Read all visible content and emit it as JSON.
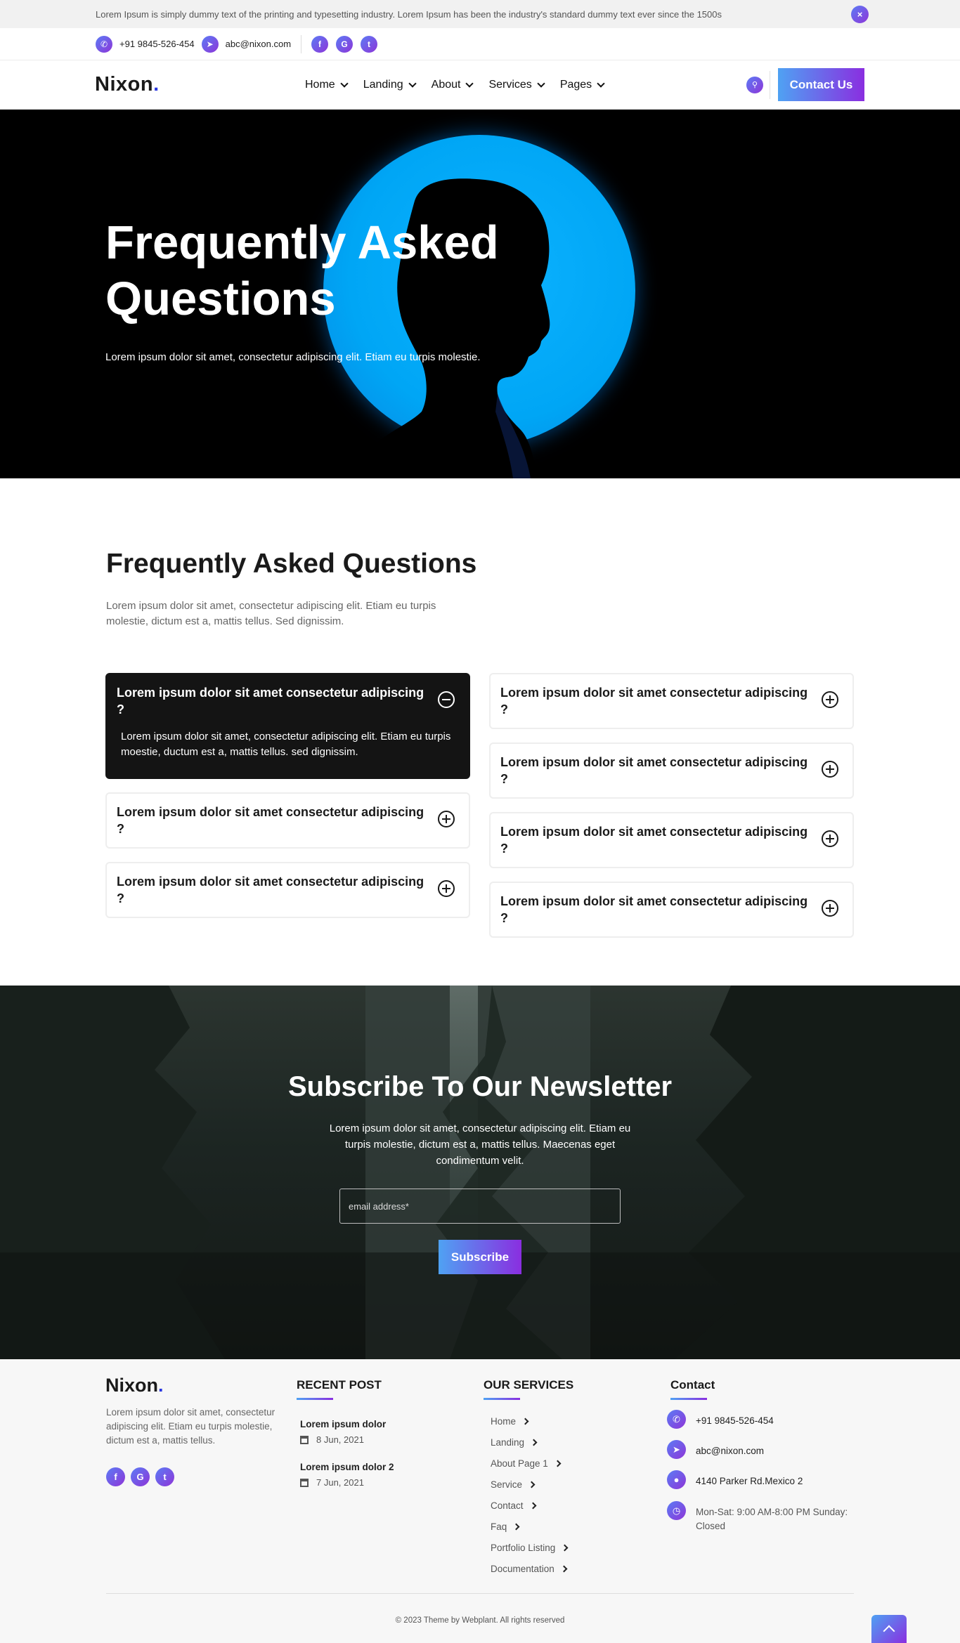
{
  "announcement": {
    "text": "Lorem Ipsum is simply dummy text of the printing and typesetting industry. Lorem Ipsum has been the industry's standard dummy text ever since the 1500s",
    "close_icon": "×"
  },
  "contact_bar": {
    "phone": "+91 9845-526-454",
    "email": "abc@nixon.com",
    "social": [
      {
        "name": "facebook-icon",
        "glyph": "f"
      },
      {
        "name": "google-icon",
        "glyph": "G"
      },
      {
        "name": "twitter-icon",
        "glyph": "t"
      }
    ]
  },
  "nav": {
    "logo": "Nixon",
    "logo_dot": ".",
    "items": [
      "Home",
      "Landing",
      "About",
      "Services",
      "Pages"
    ],
    "contact_button": "Contact Us"
  },
  "hero": {
    "title": "Frequently Asked Questions",
    "subtitle": "Lorem ipsum dolor sit amet, consectetur adipiscing elit. Etiam eu turpis molestie."
  },
  "faq": {
    "title": "Frequently Asked Questions",
    "description": "Lorem ipsum dolor sit amet, consectetur adipiscing elit. Etiam eu turpis molestie, dictum est a, mattis tellus. Sed dignissim.",
    "items": [
      {
        "question": "Lorem ipsum dolor sit amet consectetur adipiscing ?",
        "answer": "Lorem ipsum dolor sit amet, consectetur adipiscing elit. Etiam eu turpis moestie, ductum est a, mattis tellus. sed dignissim.",
        "open": true
      },
      {
        "question": "Lorem ipsum dolor sit amet consectetur adipiscing ?",
        "open": false
      },
      {
        "question": "Lorem ipsum dolor sit amet consectetur adipiscing ?",
        "open": false
      },
      {
        "question": "Lorem ipsum dolor sit amet consectetur adipiscing ?",
        "open": false
      },
      {
        "question": "Lorem ipsum dolor sit amet consectetur adipiscing ?",
        "open": false
      },
      {
        "question": "Lorem ipsum dolor sit amet consectetur adipiscing ?",
        "open": false
      },
      {
        "question": "Lorem ipsum dolor sit amet consectetur adipiscing ?",
        "open": false
      }
    ]
  },
  "newsletter": {
    "title": "Subscribe To Our Newsletter",
    "description": "Lorem ipsum dolor sit amet, consectetur adipiscing elit. Etiam eu turpis molestie, dictum est a, mattis tellus. Maecenas eget condimentum velit.",
    "email_placeholder": "email address*",
    "button": "Subscribe"
  },
  "footer": {
    "logo": "Nixon",
    "logo_dot": ".",
    "about": "Lorem ipsum dolor sit amet, consectetur adipiscing elit. Etiam eu turpis molestie, dictum est a, mattis tellus.",
    "recent_post_heading": "RECENT POST",
    "posts": [
      {
        "title": "Lorem ipsum dolor",
        "date": "8 Jun, 2021"
      },
      {
        "title": "Lorem ipsum dolor 2",
        "date": "7 Jun, 2021"
      }
    ],
    "services_heading": "OUR SERVICES",
    "services": [
      "Home",
      "Landing",
      "About Page 1",
      "Service",
      "Contact",
      "Faq",
      "Portfolio Listing",
      "Documentation"
    ],
    "contact_heading": "Contact",
    "contact": {
      "phone": "+91 9845-526-454",
      "email": "abc@nixon.com",
      "address": "4140 Parker Rd.Mexico 2",
      "hours": "Mon-Sat: 9:00 AM-8:00 PM Sunday: Closed"
    },
    "copyright": "© 2023 Theme by Webplant. All rights reserved"
  },
  "colors": {
    "accent_start": "#4fa2f3",
    "accent_end": "#8a2ee0",
    "hero_circle": "#00a6f5",
    "dark_card": "#141414"
  }
}
